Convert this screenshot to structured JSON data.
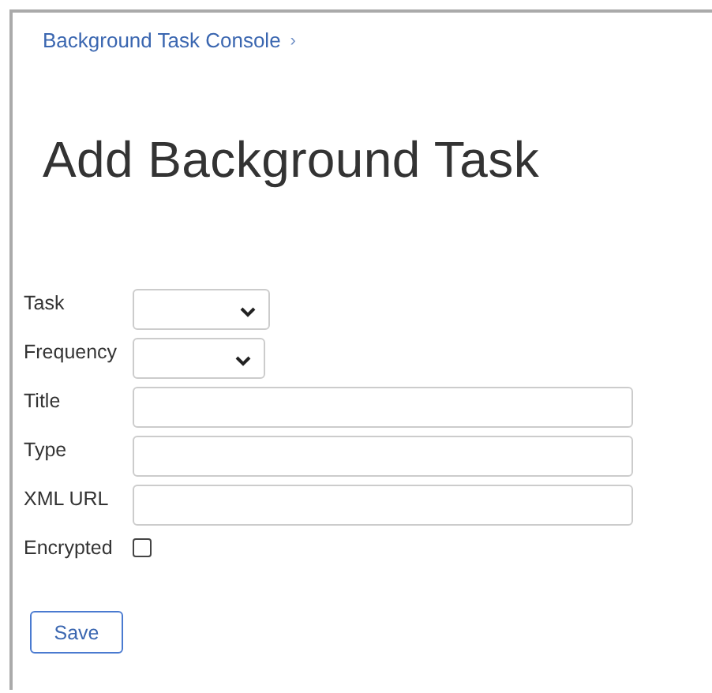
{
  "breadcrumb": {
    "label": "Background Task Console",
    "separator": "›"
  },
  "heading": "Add Background Task",
  "fields": [
    {
      "label": "Task",
      "kind": "select"
    },
    {
      "label": "Frequency",
      "kind": "select"
    },
    {
      "label": "Title",
      "kind": "text"
    },
    {
      "label": "Type",
      "kind": "text"
    },
    {
      "label": "XML URL",
      "kind": "text"
    },
    {
      "label": "Encrypted",
      "kind": "checkbox",
      "checked": false
    }
  ],
  "buttons": [
    "Save"
  ]
}
